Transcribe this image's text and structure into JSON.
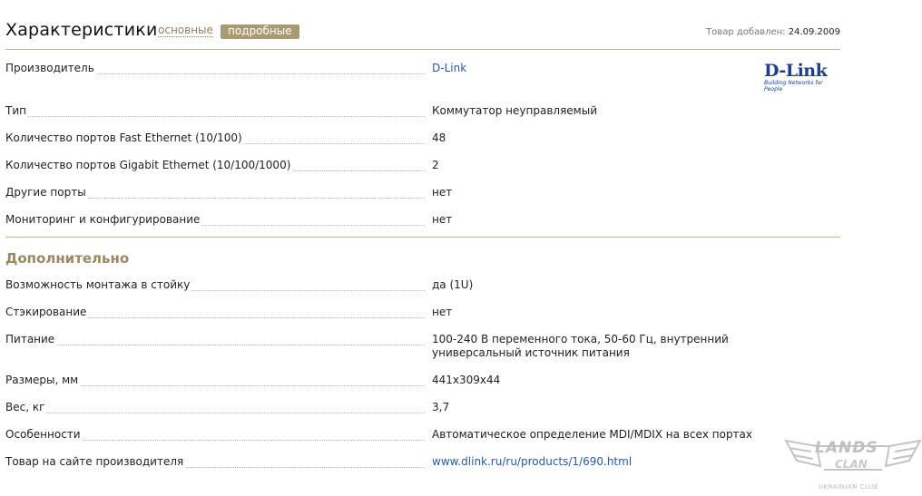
{
  "header": {
    "title": "Характеристики",
    "tab_basic": "основные",
    "tab_detailed": "подробные",
    "added_label": "Товар добавлен:",
    "added_date": "24.09.2009"
  },
  "manufacturer": {
    "label": "Производитель",
    "value": "D-Link",
    "logo_text": "D-Link",
    "logo_tagline": "Building Networks for People"
  },
  "main_specs": [
    {
      "label": "Тип",
      "value": "Коммутатор неуправляемый"
    },
    {
      "label": "Количество портов Fast Ethernet (10/100)",
      "value": "48"
    },
    {
      "label": "Количество портов Gigabit Ethernet (10/100/1000)",
      "value": "2"
    },
    {
      "label": "Другие порты",
      "value": "нет"
    },
    {
      "label": "Мониторинг и конфигурирование",
      "value": "нет"
    }
  ],
  "extra_section": {
    "title": "Дополнительно",
    "specs": [
      {
        "label": "Возможность монтажа в стойку",
        "value": "да (1U)"
      },
      {
        "label": "Стэкирование",
        "value": "нет"
      },
      {
        "label": "Питание",
        "value": "100-240 В переменного тока, 50-60 Гц, внутренний универсальный источник питания"
      },
      {
        "label": "Размеры, мм",
        "value": "441x309x44"
      },
      {
        "label": "Вес, кг",
        "value": "3,7"
      },
      {
        "label": "Особенности",
        "value": "Автоматическое определение MDI/MDIX на всех портах"
      }
    ],
    "site": {
      "label": "Товар на сайте производителя",
      "value": "www.dlink.ru/ru/products/1/690.html"
    }
  },
  "watermark": {
    "text": "LANDS",
    "sub": "CLAN",
    "club": "UKRAINIAN CLUB"
  },
  "colors": {
    "accent": "#a99a74",
    "link": "#2a59a8",
    "section": "#9a8a62"
  }
}
